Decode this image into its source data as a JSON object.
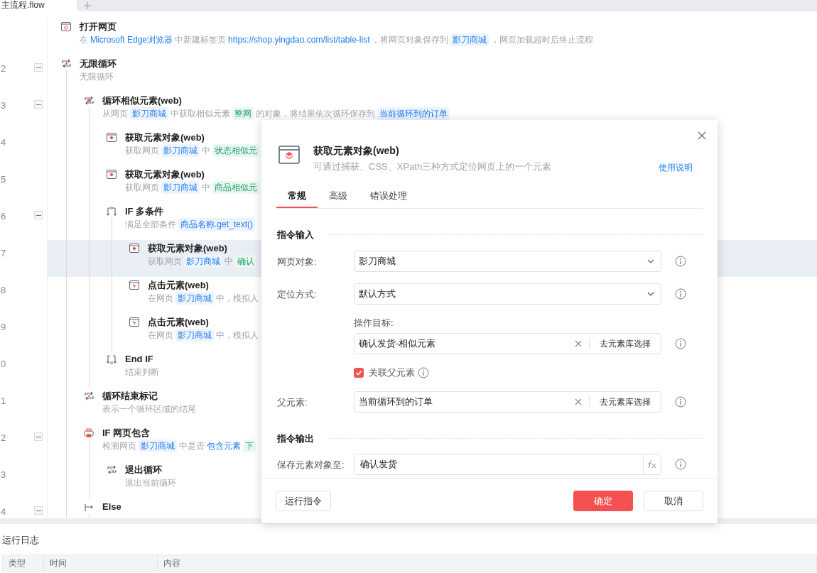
{
  "file_tabs": [
    {
      "label": "主流程.flow",
      "selected": true
    }
  ],
  "tree": {
    "rows": [
      {
        "kind": "open-page",
        "title": "打开网页",
        "selected": false,
        "desc": [
          {
            "kind": "text",
            "text": "在"
          },
          {
            "kind": "link",
            "text": "Microsoft Edge浏览器"
          },
          {
            "kind": "text",
            "text": "中新建标签页"
          },
          {
            "kind": "link",
            "text": "https://shop.yingdao.com/list/table-list"
          },
          {
            "kind": "text",
            "text": "，将网页对象保存到"
          },
          {
            "kind": "var",
            "text": "影刀商城"
          },
          {
            "kind": "text",
            "text": "，网页加载超时后终止流程"
          }
        ]
      },
      {
        "kind": "loop",
        "line": "2",
        "title": "无限循环",
        "selected": false,
        "expanded": true,
        "desc": [
          {
            "kind": "text",
            "text": "无限循环"
          }
        ],
        "children": [
          {
            "kind": "loop-similar",
            "line": "3",
            "title": "循环相似元素(web)",
            "selected": false,
            "expanded": true,
            "desc": [
              {
                "kind": "text",
                "text": "从网页"
              },
              {
                "kind": "var",
                "text": "影刀商城"
              },
              {
                "kind": "text",
                "text": "中获取相似元素"
              },
              {
                "kind": "el",
                "text": "整网"
              },
              {
                "kind": "text",
                "text": "的对象，将结果依次循环保存到"
              },
              {
                "kind": "var",
                "text": "当前循环到的订单"
              }
            ],
            "children": [
              {
                "kind": "element",
                "line": "4",
                "title": "获取元素对象(web)",
                "selected": false,
                "desc": [
                  {
                    "kind": "text",
                    "text": "获取网页"
                  },
                  {
                    "kind": "var",
                    "text": "影刀商城"
                  },
                  {
                    "kind": "text",
                    "text": "中"
                  },
                  {
                    "kind": "el",
                    "text": "状态相似元"
                  }
                ]
              },
              {
                "kind": "element",
                "line": "5",
                "title": "获取元素对象(web)",
                "selected": false,
                "desc": [
                  {
                    "kind": "text",
                    "text": "获取网页"
                  },
                  {
                    "kind": "var",
                    "text": "影刀商城"
                  },
                  {
                    "kind": "text",
                    "text": "中"
                  },
                  {
                    "kind": "el",
                    "text": "商品相似元"
                  }
                ]
              },
              {
                "kind": "if",
                "line": "6",
                "title": "IF 多条件",
                "selected": false,
                "expanded": true,
                "desc": [
                  {
                    "kind": "text",
                    "text": "满足全部条件"
                  },
                  {
                    "kind": "var",
                    "text": "商品名称.get_text()"
                  }
                ],
                "children": [
                  {
                    "kind": "element",
                    "line": "7",
                    "title": "获取元素对象(web)",
                    "selected": true,
                    "desc": [
                      {
                        "kind": "text",
                        "text": "获取网页"
                      },
                      {
                        "kind": "var",
                        "text": "影刀商城"
                      },
                      {
                        "kind": "text",
                        "text": "中"
                      },
                      {
                        "kind": "el",
                        "text": "确认"
                      }
                    ]
                  },
                  {
                    "kind": "click",
                    "line": "8",
                    "title": "点击元素(web)",
                    "selected": false,
                    "desc": [
                      {
                        "kind": "text",
                        "text": "在网页"
                      },
                      {
                        "kind": "var",
                        "text": "影刀商城"
                      },
                      {
                        "kind": "text",
                        "text": "中，模拟人"
                      }
                    ]
                  },
                  {
                    "kind": "click",
                    "line": "9",
                    "title": "点击元素(web)",
                    "selected": false,
                    "desc": [
                      {
                        "kind": "text",
                        "text": "在网页"
                      },
                      {
                        "kind": "var",
                        "text": "影刀商城"
                      },
                      {
                        "kind": "text",
                        "text": "中，模拟人"
                      }
                    ]
                  }
                ]
              },
              {
                "kind": "endif",
                "line": "0",
                "title": "End IF",
                "selected": false,
                "desc": [
                  {
                    "kind": "text",
                    "text": "结束判断"
                  }
                ]
              }
            ]
          },
          {
            "kind": "loop-end",
            "line": "1",
            "title": "循环结束标记",
            "selected": false,
            "desc": [
              {
                "kind": "text",
                "text": "表示一个循环区域的结尾"
              }
            ]
          },
          {
            "kind": "if-page",
            "line": "2",
            "title": "IF 网页包含",
            "selected": false,
            "expanded": true,
            "desc": [
              {
                "kind": "text",
                "text": "检测网页"
              },
              {
                "kind": "var",
                "text": "影刀商城"
              },
              {
                "kind": "text",
                "text": "中是否"
              },
              {
                "kind": "link",
                "text": "包含元素"
              },
              {
                "kind": "el",
                "text": "下"
              }
            ],
            "children": [
              {
                "kind": "exit-loop",
                "line": "3",
                "title": "退出循环",
                "selected": false,
                "desc": [
                  {
                    "kind": "text",
                    "text": "退出当前循环"
                  }
                ]
              }
            ]
          },
          {
            "kind": "else",
            "line": "4",
            "title": "Else",
            "selected": false,
            "expanded": true
          }
        ]
      }
    ]
  },
  "log": {
    "title": "运行日志",
    "columns": [
      "类型",
      "时间",
      "内容"
    ]
  },
  "dialog": {
    "title": "获取元素对象(web)",
    "subtitle": "可通过捕获、CSS、XPath三种方式定位网页上的一个元素",
    "help": "使用说明",
    "tabs": [
      {
        "label": "常规",
        "selected": true
      },
      {
        "label": "高级",
        "selected": false
      },
      {
        "label": "错误处理",
        "selected": false
      }
    ],
    "sections": [
      {
        "title": "指令输入",
        "fields": [
          {
            "kind": "select",
            "label": "网页对象:",
            "value": "影刀商城"
          },
          {
            "kind": "select",
            "label": "定位方式:",
            "value": "默认方式"
          },
          {
            "kind": "picker",
            "sublabel": "操作目标:",
            "value": "确认发货-相似元素",
            "button": "去元素库选择"
          },
          {
            "kind": "checkbox",
            "text": "关联父元素",
            "checked": true
          },
          {
            "kind": "picker",
            "label": "父元素:",
            "value": "当前循环到的订单",
            "button": "去元素库选择"
          }
        ]
      },
      {
        "title": "指令输出",
        "fields": [
          {
            "kind": "input-fx",
            "label": "保存元素对象至:",
            "value": "确认发货"
          }
        ]
      }
    ],
    "buttons": [
      {
        "kind": "secondary",
        "label": "运行指令"
      },
      {
        "kind": "primary",
        "label": "确定"
      },
      {
        "kind": "default",
        "label": "取消"
      }
    ]
  }
}
